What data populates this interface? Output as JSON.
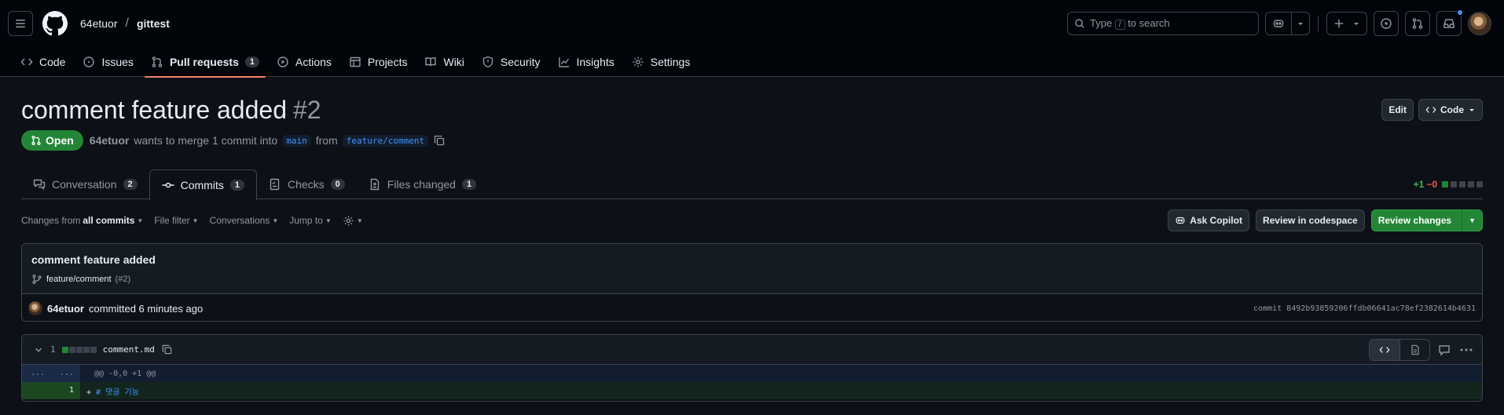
{
  "header": {
    "owner": "64etuor",
    "repo": "gittest",
    "search_placeholder": "Type / to search"
  },
  "repo_nav": [
    {
      "label": "Code",
      "icon": "code-icon"
    },
    {
      "label": "Issues",
      "icon": "issue-icon"
    },
    {
      "label": "Pull requests",
      "icon": "pull-request-icon",
      "count": "1",
      "active": true
    },
    {
      "label": "Actions",
      "icon": "play-icon"
    },
    {
      "label": "Projects",
      "icon": "table-icon"
    },
    {
      "label": "Wiki",
      "icon": "book-icon"
    },
    {
      "label": "Security",
      "icon": "shield-icon"
    },
    {
      "label": "Insights",
      "icon": "graph-icon"
    },
    {
      "label": "Settings",
      "icon": "gear-icon"
    }
  ],
  "pr": {
    "title": "comment feature added",
    "number": "#2",
    "state": "Open",
    "author": "64etuor",
    "merge_text": "wants to merge 1 commit into",
    "base_branch": "main",
    "from_text": "from",
    "head_branch": "feature/comment",
    "edit_label": "Edit",
    "code_label": "Code"
  },
  "tabs": [
    {
      "label": "Conversation",
      "count": "2"
    },
    {
      "label": "Commits",
      "count": "1",
      "active": true
    },
    {
      "label": "Checks",
      "count": "0"
    },
    {
      "label": "Files changed",
      "count": "1"
    }
  ],
  "diffstat": {
    "additions": "+1",
    "deletions": "−0"
  },
  "toolbar": {
    "changes_from": "Changes from",
    "all_commits": "all commits",
    "file_filter": "File filter",
    "conversations": "Conversations",
    "jump_to": "Jump to",
    "ask_copilot": "Ask Copilot",
    "review_codespace": "Review in codespace",
    "review_changes": "Review changes"
  },
  "commit": {
    "title": "comment feature added",
    "branch": "feature/comment",
    "pr_ref": "(#2)",
    "author": "64etuor",
    "committed_text": "committed 6 minutes ago",
    "sha_text": "commit 8492b93859206ffdb06641ac78ef2382614b4631"
  },
  "file": {
    "count": "1",
    "name": "comment.md",
    "hunk_left": "...",
    "hunk_right": "...",
    "hunk_header": "@@ -0,0 +1 @@",
    "line_num": "1",
    "line_sign": "+",
    "line_code": "# 댓글 기능"
  },
  "colors": {
    "accent": "#f78166",
    "open_green": "#238636",
    "link_blue": "#4493f8"
  }
}
